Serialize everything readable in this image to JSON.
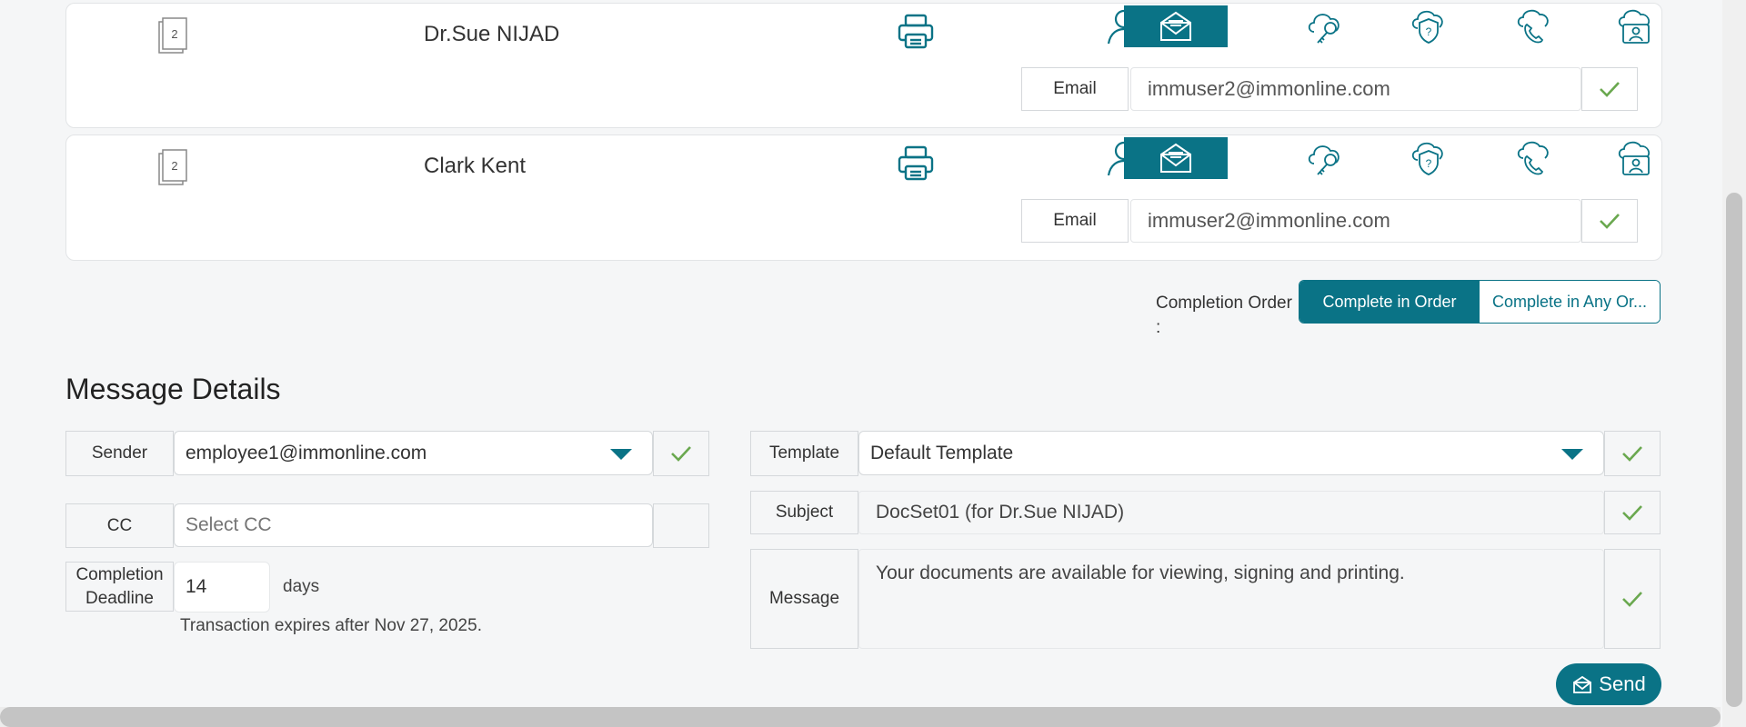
{
  "recipients": [
    {
      "name": "Dr.Sue NIJAD",
      "doc_count": "2",
      "field_label": "Email",
      "email": "immuser2@immonline.com"
    },
    {
      "name": "Clark Kent",
      "doc_count": "2",
      "field_label": "Email",
      "email": "immuser2@immonline.com"
    }
  ],
  "icons": [
    "print-icon",
    "person-icon",
    "email-icon",
    "cloud-key-icon",
    "shield-question-icon",
    "cloud-phone-icon",
    "cloud-id-icon"
  ],
  "completion_order": {
    "label_line1": "Completion Order",
    "label_line2": ":",
    "options": [
      "Complete in Order",
      "Complete in Any Or..."
    ],
    "selected": "Complete in Order"
  },
  "message_details": {
    "title": "Message Details",
    "sender": {
      "label": "Sender",
      "value": "employee1@immonline.com"
    },
    "cc": {
      "label": "CC",
      "placeholder": "Select CC"
    },
    "deadline": {
      "label_line1": "Completion",
      "label_line2": "Deadline",
      "value": "14",
      "unit": "days",
      "note": "Transaction expires after Nov 27, 2025."
    },
    "template": {
      "label": "Template",
      "value": "Default Template"
    },
    "subject": {
      "label": "Subject",
      "value": "DocSet01 (for Dr.Sue NIJAD)"
    },
    "message": {
      "label": "Message",
      "value": "Your documents are available for viewing, signing and printing."
    }
  },
  "send_button": "Send",
  "colors": {
    "accent": "#0a7386",
    "check": "#6aa84f"
  }
}
